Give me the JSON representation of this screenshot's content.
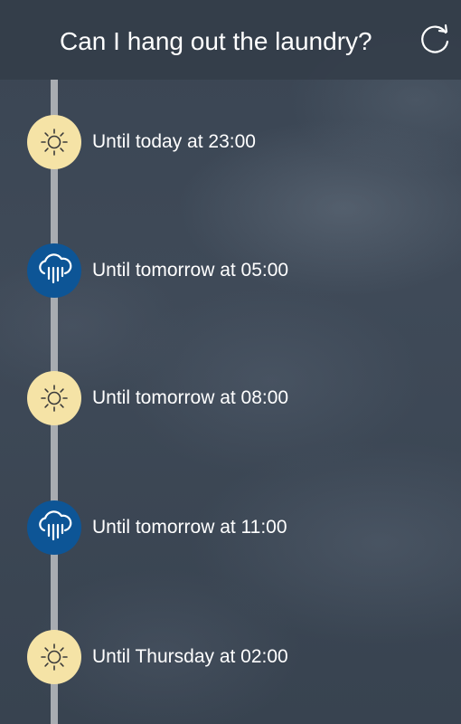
{
  "header": {
    "title": "Can I hang out the laundry?",
    "refresh_icon": "refresh-icon"
  },
  "timeline": [
    {
      "condition": "sunny",
      "icon": "sun-icon",
      "label": "Until today at 23:00"
    },
    {
      "condition": "rainy",
      "icon": "rain-cloud-icon",
      "label": "Until tomorrow at 05:00"
    },
    {
      "condition": "sunny",
      "icon": "sun-icon",
      "label": "Until tomorrow at 08:00"
    },
    {
      "condition": "rainy",
      "icon": "rain-cloud-icon",
      "label": "Until tomorrow at 11:00"
    },
    {
      "condition": "sunny",
      "icon": "sun-icon",
      "label": "Until Thursday at 02:00"
    }
  ],
  "colors": {
    "sunny_badge": "#f5e3a6",
    "rainy_badge": "#0d5596",
    "timeline_line": "#a8acb1",
    "header_bg": "#343e4a"
  }
}
